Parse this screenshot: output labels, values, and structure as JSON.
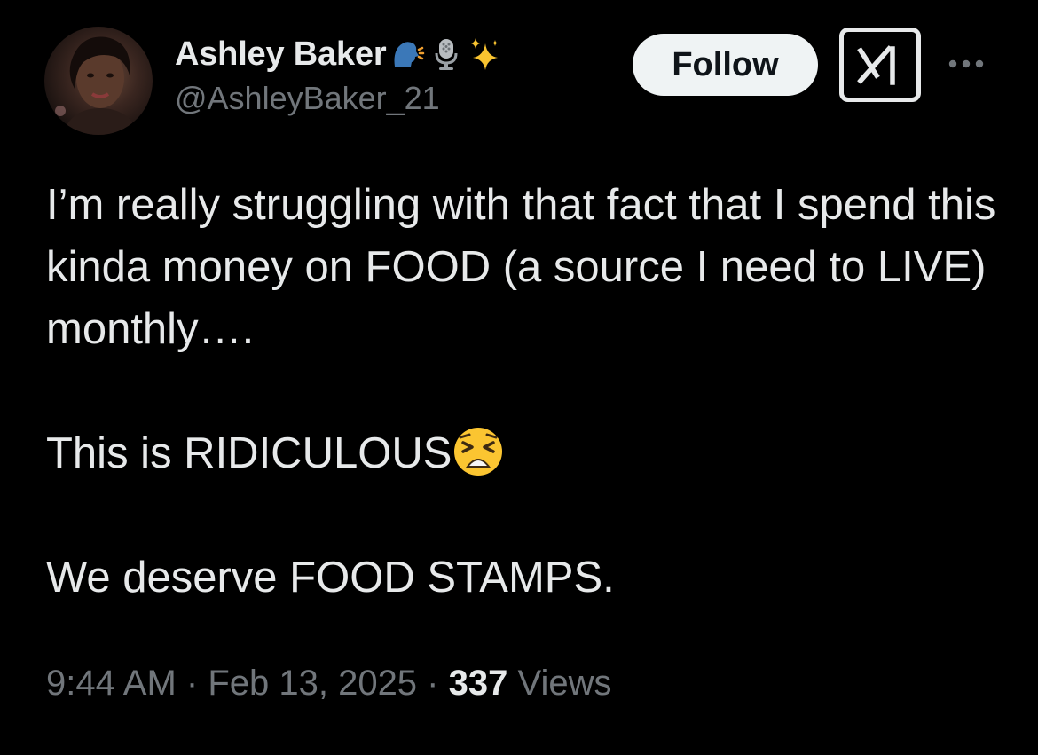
{
  "user": {
    "display_name": "Ashley Baker",
    "handle": "@AshleyBaker_21",
    "name_emojis": [
      "speaking-head-emoji",
      "microphone-emoji",
      "sparkles-emoji"
    ]
  },
  "actions": {
    "follow_label": "Follow",
    "grok_icon": "grok-icon",
    "more_icon": "more-options-icon"
  },
  "tweet": {
    "line_1": "I’m really struggling with that fact that I spend this kinda money on FOOD (a source I need to LIVE) monthly….",
    "line_2": "This is RIDICULOUS",
    "line_2_emoji": "tired-face-emoji",
    "line_3": "We deserve FOOD STAMPS."
  },
  "meta": {
    "time": "9:44 AM",
    "date": "Feb 13, 2025",
    "separator": " · ",
    "views_count": "337",
    "views_label": "Views"
  },
  "colors": {
    "background": "#000000",
    "primary_text": "#e7e9ea",
    "secondary_text": "#71767b",
    "follow_bg": "#eff3f4"
  }
}
